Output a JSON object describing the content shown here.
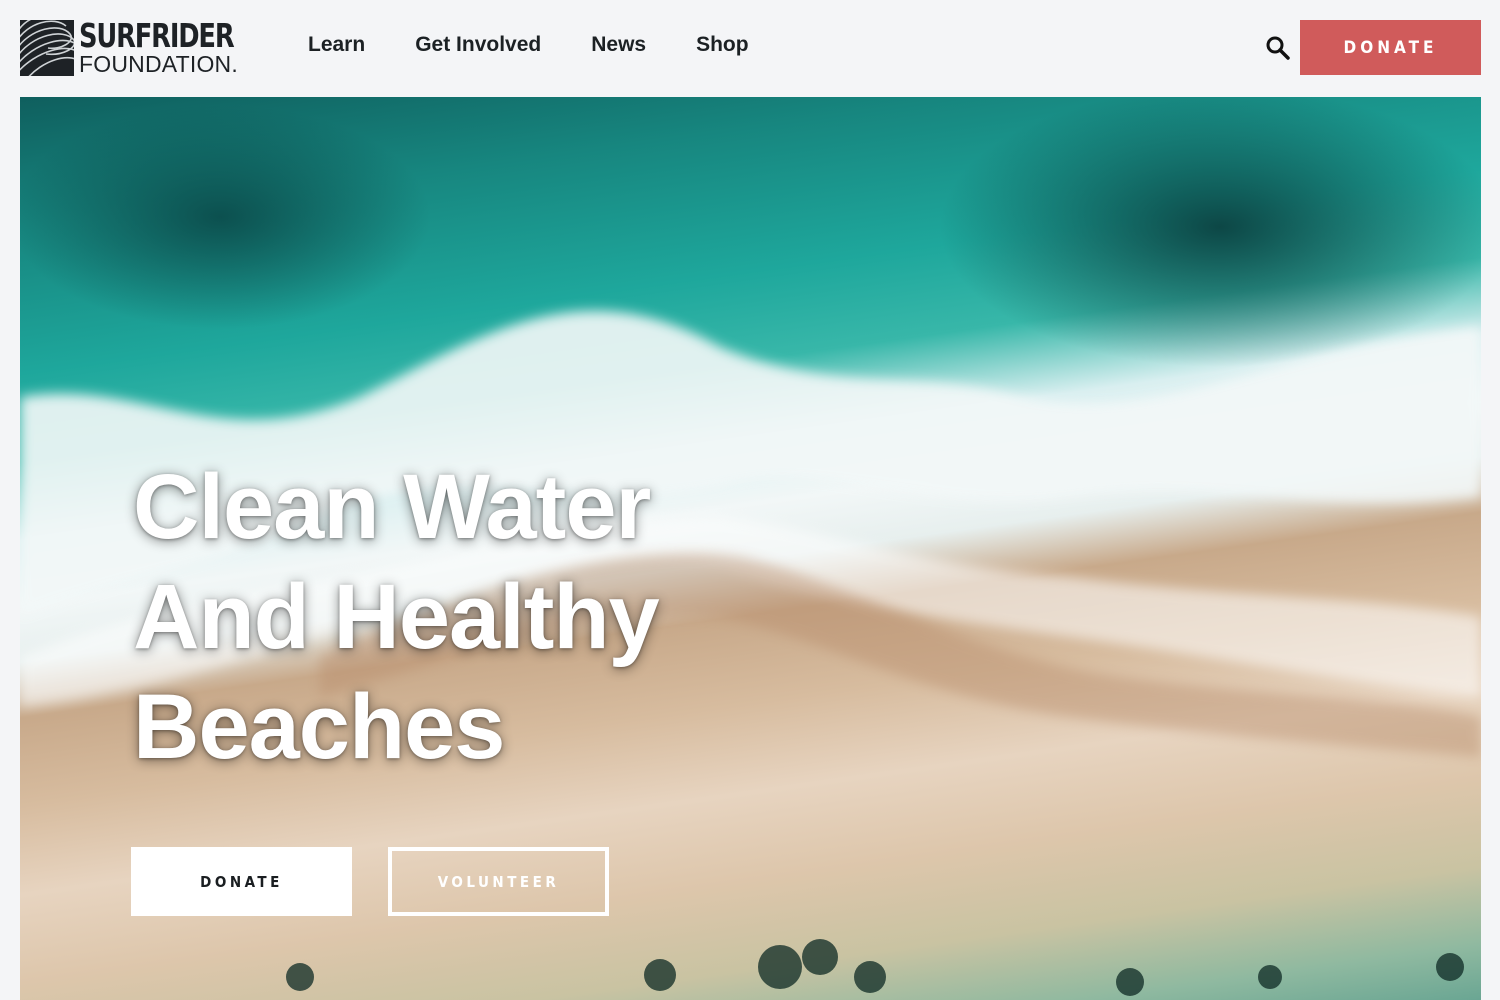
{
  "header": {
    "logo": {
      "line1": "SURFRIDER",
      "line2": "FOUNDATION."
    },
    "nav": [
      {
        "label": "Learn"
      },
      {
        "label": "Get Involved"
      },
      {
        "label": "News"
      },
      {
        "label": "Shop"
      }
    ],
    "search_icon": "search-icon",
    "donate_label": "DONATE",
    "donate_color": "#d05b5b"
  },
  "hero": {
    "title": "Clean Water And Healthy Beaches",
    "primary_button": "DONATE",
    "secondary_button": "VOLUNTEER"
  }
}
